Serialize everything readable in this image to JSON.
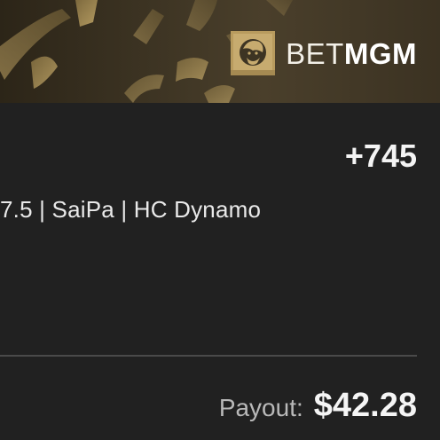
{
  "banner": {
    "brand_prefix": "BET",
    "brand_suffix": "MGM",
    "colors": {
      "gold": "#b89b5e",
      "background": "#3d3423"
    }
  },
  "bet": {
    "odds": "+745",
    "selection": "7.5 | SaiPa | HC Dynamo"
  },
  "payout": {
    "label": "Payout:",
    "value": "$42.28"
  },
  "icons": {
    "logo": "betmgm-lion-logo-icon"
  },
  "colors": {
    "page_background": "#212121",
    "text_primary": "#f4f4f4",
    "text_secondary": "#b9b9b9",
    "divider": "#4a4a4a"
  }
}
